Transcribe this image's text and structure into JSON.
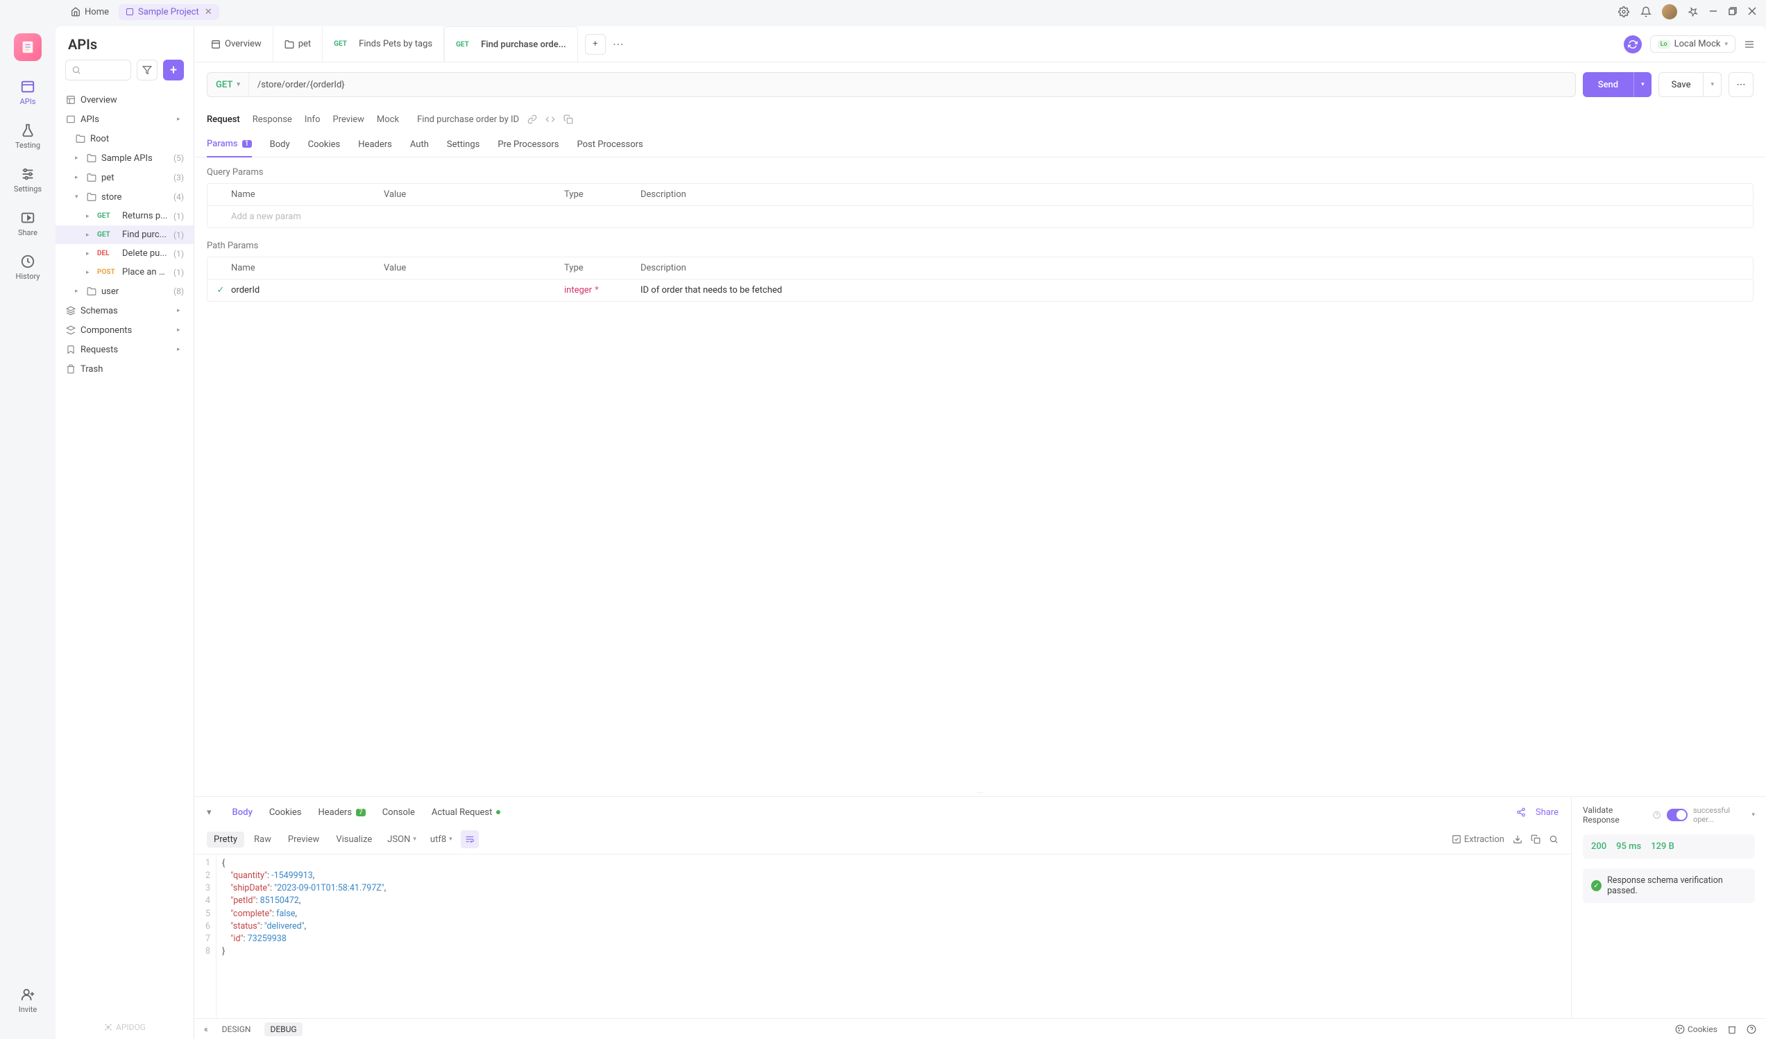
{
  "titlebar": {
    "home": "Home",
    "project": "Sample Project"
  },
  "nav": {
    "apis": "APIs",
    "testing": "Testing",
    "settings": "Settings",
    "share": "Share",
    "history": "History",
    "invite": "Invite"
  },
  "sidebar": {
    "title": "APIs",
    "overview": "Overview",
    "apis_label": "APIs",
    "root": "Root",
    "sample_apis": "Sample APIs",
    "sample_apis_count": "(5)",
    "pet": "pet",
    "pet_count": "(3)",
    "store": "store",
    "store_count": "(4)",
    "store_items": [
      {
        "method": "GET",
        "label": "Returns p...",
        "count": "(1)"
      },
      {
        "method": "GET",
        "label": "Find purc...",
        "count": "(1)"
      },
      {
        "method": "DEL",
        "label": "Delete pu...",
        "count": "(1)"
      },
      {
        "method": "POST",
        "label": "Place an o...",
        "count": "(1)"
      }
    ],
    "user": "user",
    "user_count": "(8)",
    "schemas": "Schemas",
    "components": "Components",
    "requests": "Requests",
    "trash": "Trash",
    "brand": "APIDOG"
  },
  "tabs": {
    "overview": "Overview",
    "pet": "pet",
    "finds": "Finds Pets by tags",
    "find_order": "Find purchase orde..."
  },
  "env": {
    "label": "Local Mock",
    "badge": "Lo"
  },
  "url": {
    "method": "GET",
    "path": "/store/order/{orderId}"
  },
  "actions": {
    "send": "Send",
    "save": "Save"
  },
  "subtabs": {
    "request": "Request",
    "response": "Response",
    "info": "Info",
    "preview": "Preview",
    "mock": "Mock",
    "title": "Find purchase order by ID"
  },
  "reqtabs": {
    "params": "Params",
    "params_count": "1",
    "body": "Body",
    "cookies": "Cookies",
    "headers": "Headers",
    "auth": "Auth",
    "settings": "Settings",
    "pre": "Pre Processors",
    "post": "Post Processors"
  },
  "params": {
    "query_title": "Query Params",
    "path_title": "Path Params",
    "cols": {
      "name": "Name",
      "value": "Value",
      "type": "Type",
      "description": "Description"
    },
    "add_placeholder": "Add a new param",
    "path_row": {
      "name": "orderId",
      "value": "",
      "type": "integer",
      "description": "ID of order that needs to be fetched"
    }
  },
  "resp": {
    "tabs": {
      "body": "Body",
      "cookies": "Cookies",
      "headers": "Headers",
      "headers_count": "7",
      "console": "Console",
      "actual": "Actual Request"
    },
    "share": "Share",
    "toolbar": {
      "pretty": "Pretty",
      "raw": "Raw",
      "preview": "Preview",
      "visualize": "Visualize",
      "format": "JSON",
      "enc": "utf8",
      "extraction": "Extraction"
    },
    "json": {
      "quantity": -15499913,
      "shipDate": "2023-09-01T01:58:41.797Z",
      "petId": 85150472,
      "complete": false,
      "status": "delivered",
      "id": 73259938
    },
    "validate_label": "Validate Response",
    "validate_sel": "successful oper...",
    "status": "200",
    "time": "95 ms",
    "size": "129 B",
    "verify": "Response schema verification passed."
  },
  "footer": {
    "design": "DESIGN",
    "debug": "DEBUG",
    "cookies": "Cookies"
  }
}
